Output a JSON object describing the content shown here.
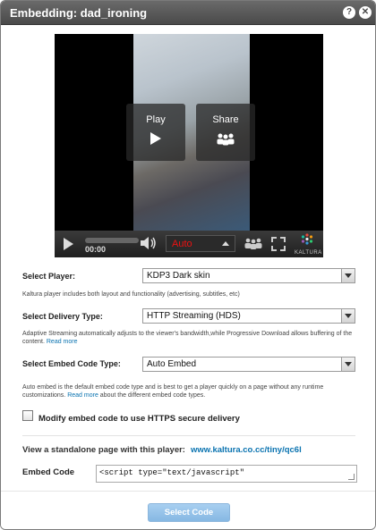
{
  "dialog": {
    "title": "Embedding: dad_ironing",
    "help_icon": "question-icon",
    "close_icon": "close-icon"
  },
  "player": {
    "overlay_play": "Play",
    "overlay_share": "Share",
    "time": "00:00",
    "flavor": "Auto",
    "logo_text": "KALTURA",
    "progress_fraction": 0
  },
  "select_player": {
    "label": "Select Player:",
    "value": "KDP3 Dark skin",
    "help": "Kaltura player includes both layout and functionality (advertising, subtitles, etc)"
  },
  "delivery": {
    "label": "Select Delivery Type:",
    "value": "HTTP Streaming (HDS)",
    "help": "Adaptive Streaming automatically adjusts to the viewer's bandwidth,while Progressive Download allows buffering of the content.",
    "read_more": "Read more"
  },
  "embed_type": {
    "label": "Select Embed Code Type:",
    "value": "Auto Embed",
    "help_before": "Auto embed is the default embed code type and is best to get a player quickly on a page without any runtime customizations.",
    "read_more": "Read more",
    "help_after": "about the different embed code types."
  },
  "https": {
    "label": "Modify embed code to use HTTPS secure delivery",
    "checked": false
  },
  "standalone": {
    "label": "View a standalone page with this player:",
    "link": "www.kaltura.co.cc/tiny/qc6l"
  },
  "embed_code": {
    "label": "Embed Code",
    "value": "<script type=\"text/javascript\""
  },
  "footer": {
    "select_code": "Select Code"
  },
  "colors": {
    "titlebar": "#555555",
    "link": "#0a73b0",
    "primary_button": "#96c3ea",
    "flavor_text": "#ee1111"
  }
}
